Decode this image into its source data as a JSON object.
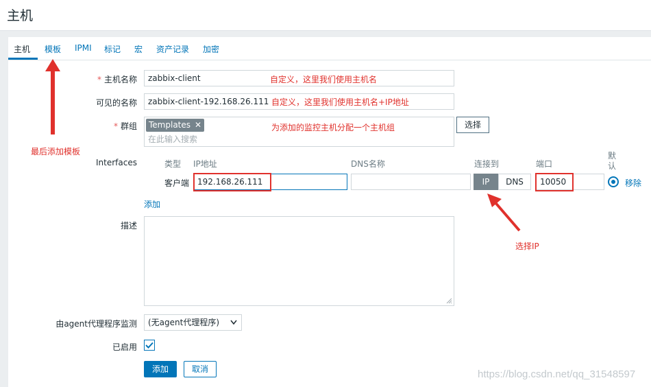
{
  "page": {
    "title": "主机"
  },
  "tabs": [
    {
      "label": "主机"
    },
    {
      "label": "模板"
    },
    {
      "label": "IPMI"
    },
    {
      "label": "标记"
    },
    {
      "label": "宏"
    },
    {
      "label": "资产记录"
    },
    {
      "label": "加密"
    }
  ],
  "form": {
    "host_name": {
      "label": "主机名称",
      "value": "zabbix-client"
    },
    "visible_name": {
      "label": "可见的名称",
      "value": "zabbix-client-192.168.26.111"
    },
    "groups": {
      "label": "群组",
      "tag": "Templates",
      "placeholder": "在此输入搜索",
      "select_label": "选择"
    },
    "interfaces": {
      "label": "Interfaces",
      "headers": {
        "type": "类型",
        "ip": "IP地址",
        "dns": "DNS名称",
        "connect": "连接到",
        "port": "端口",
        "default": "默认"
      },
      "row": {
        "type": "客户端",
        "ip": "192.168.26.111",
        "dns": "",
        "ip_option": "IP",
        "dns_option": "DNS",
        "port": "10050",
        "remove": "移除"
      },
      "add_label": "添加"
    },
    "description": {
      "label": "描述",
      "value": ""
    },
    "proxy": {
      "label": "由agent代理程序监测",
      "value": "(无agent代理程序)"
    },
    "enabled": {
      "label": "已启用",
      "checked": true
    },
    "buttons": {
      "add": "添加",
      "cancel": "取消"
    }
  },
  "annotations": {
    "host_name_note": "自定义，这里我们使用主机名",
    "visible_name_note": "自定义，这里我们使用主机名+IP地址",
    "group_note": "为添加的监控主机分配一个主机组",
    "template_note": "最后添加模板",
    "ip_note": "选择IP"
  },
  "watermark": "https://blog.csdn.net/qq_31548597",
  "colors": {
    "accent": "#0275b8",
    "annotation": "#e0312c",
    "background": "#ebeef0"
  }
}
